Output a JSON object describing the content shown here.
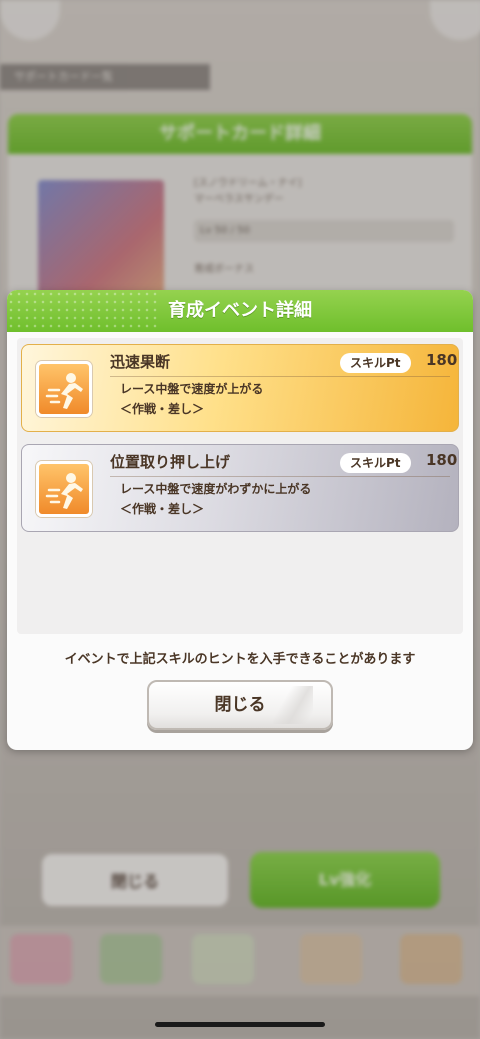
{
  "background": {
    "top_label": "サポートカード一覧",
    "card_title": "サポートカード詳細",
    "card_name_line1": "[スノウドリーム・ナイ]",
    "card_name_line2": "マーベラスサンデー",
    "card_level": "Lv 50 / 50",
    "card_bonus_label": "育成ボーナス",
    "close_button": "閉じる",
    "levelup_button": "Lv強化"
  },
  "dialog": {
    "title": "育成イベント詳細",
    "skills": [
      {
        "name": "迅速果断",
        "pt_label": "スキルPt",
        "pt_value": "180",
        "description": "レース中盤で速度が上がる",
        "tag": "＜作戦・差し＞",
        "icon": "running-speed-icon",
        "rarity_color": "#f5b53a"
      },
      {
        "name": "位置取り押し上げ",
        "pt_label": "スキルPt",
        "pt_value": "180",
        "description": "レース中盤で速度がわずかに上がる",
        "tag": "＜作戦・差し＞",
        "icon": "running-speed-icon",
        "rarity_color": "#b4b2be"
      }
    ],
    "note": "イベントで上記スキルのヒントを入手できることがあります",
    "close_button": "閉じる"
  },
  "colors": {
    "header_green": "#6fbf2c",
    "text_brown": "#4a3626"
  }
}
